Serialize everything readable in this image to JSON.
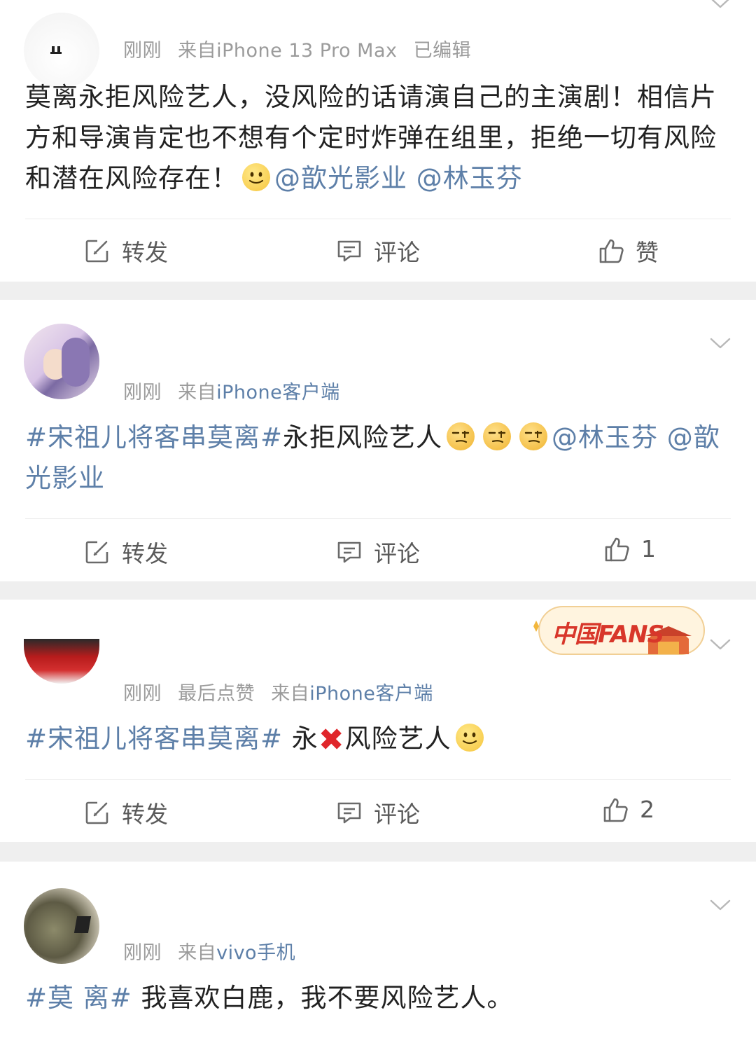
{
  "posts": [
    {
      "meta": {
        "time": "刚刚",
        "source_prefix": "来自",
        "source": "iPhone 13 Pro Max",
        "extra": "已编辑"
      },
      "text": {
        "part1": "莫离永拒风险艺人，没风险的话请演自己的主演剧！相信片方和导演肯定也不想有个定时炸弹在组里，拒绝一切有风险和潜在风险存在！",
        "mention1": "@歆光影业",
        "mention2": "@林玉芬"
      },
      "actions": {
        "repost": "转发",
        "comment": "评论",
        "like": "赞"
      }
    },
    {
      "meta": {
        "time": "刚刚",
        "source_prefix": "来自",
        "source": "iPhone客户端"
      },
      "text": {
        "tag": "#宋祖儿将客串莫离#",
        "part1": "永拒风险艺人",
        "mention1": "@林玉芬",
        "mention2": "@歆光影业"
      },
      "actions": {
        "repost": "转发",
        "comment": "评论",
        "like": "1"
      }
    },
    {
      "meta": {
        "time": "刚刚",
        "extra": "最后点赞",
        "source_prefix": "来自",
        "source": "iPhone客户端"
      },
      "text": {
        "tag": "#宋祖儿将客串莫离#",
        "part1": "永",
        "part2": "风险艺人"
      },
      "badge": "中国FANS",
      "actions": {
        "repost": "转发",
        "comment": "评论",
        "like": "2"
      }
    },
    {
      "meta": {
        "time": "刚刚",
        "source_prefix": "来自",
        "source": "vivo手机"
      },
      "text": {
        "tag": "#莫 离#",
        "part1": "我喜欢白鹿，我不要风险艺人。"
      }
    }
  ],
  "icons": {
    "repost": "edit-square-icon",
    "comment": "comment-bubble-icon",
    "like": "thumbs-up-icon",
    "menu": "chevron-down-icon"
  },
  "colors": {
    "link": "#5d7fa8",
    "meta": "#9b9b9b",
    "text": "#222222",
    "cross": "#e0262b",
    "separator": "#efefef"
  }
}
